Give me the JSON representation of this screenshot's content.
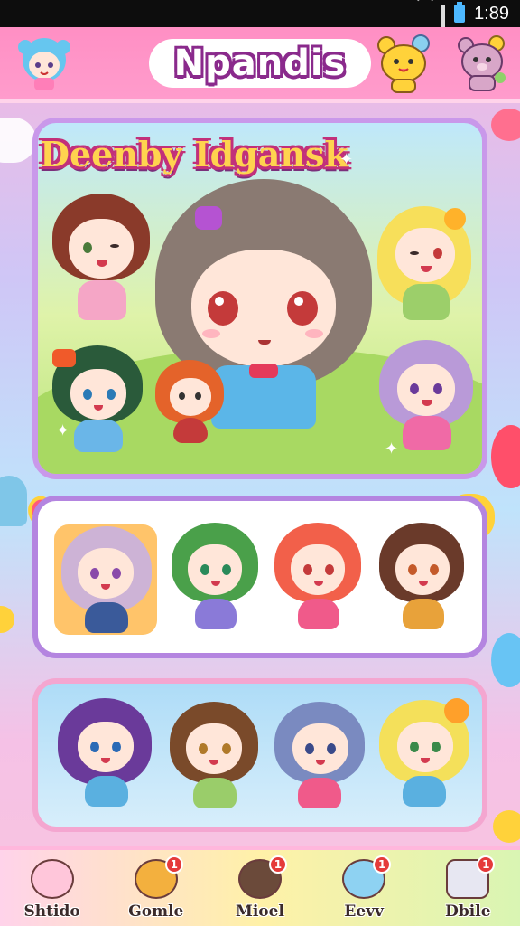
{
  "status_bar": {
    "time": "1:89"
  },
  "header": {
    "title": "Npandis"
  },
  "featured": {
    "title": "Deenby Idgansk"
  },
  "bottom_nav": [
    {
      "label": "Shtido",
      "badge": "",
      "color": "#ffc6da"
    },
    {
      "label": "Gomle",
      "badge": "1",
      "color": "#f3b03e"
    },
    {
      "label": "Mioel",
      "badge": "1",
      "color": "#6b4a3a"
    },
    {
      "label": "Eevv",
      "badge": "1",
      "color": "#8ed2f2"
    },
    {
      "label": "Dbile",
      "badge": "1",
      "color": "#e7e7f2"
    }
  ],
  "colors": {
    "header_bg": "#ff9ccc",
    "panel_border": "#c998ea",
    "title_outline": "#8a2a8c"
  }
}
